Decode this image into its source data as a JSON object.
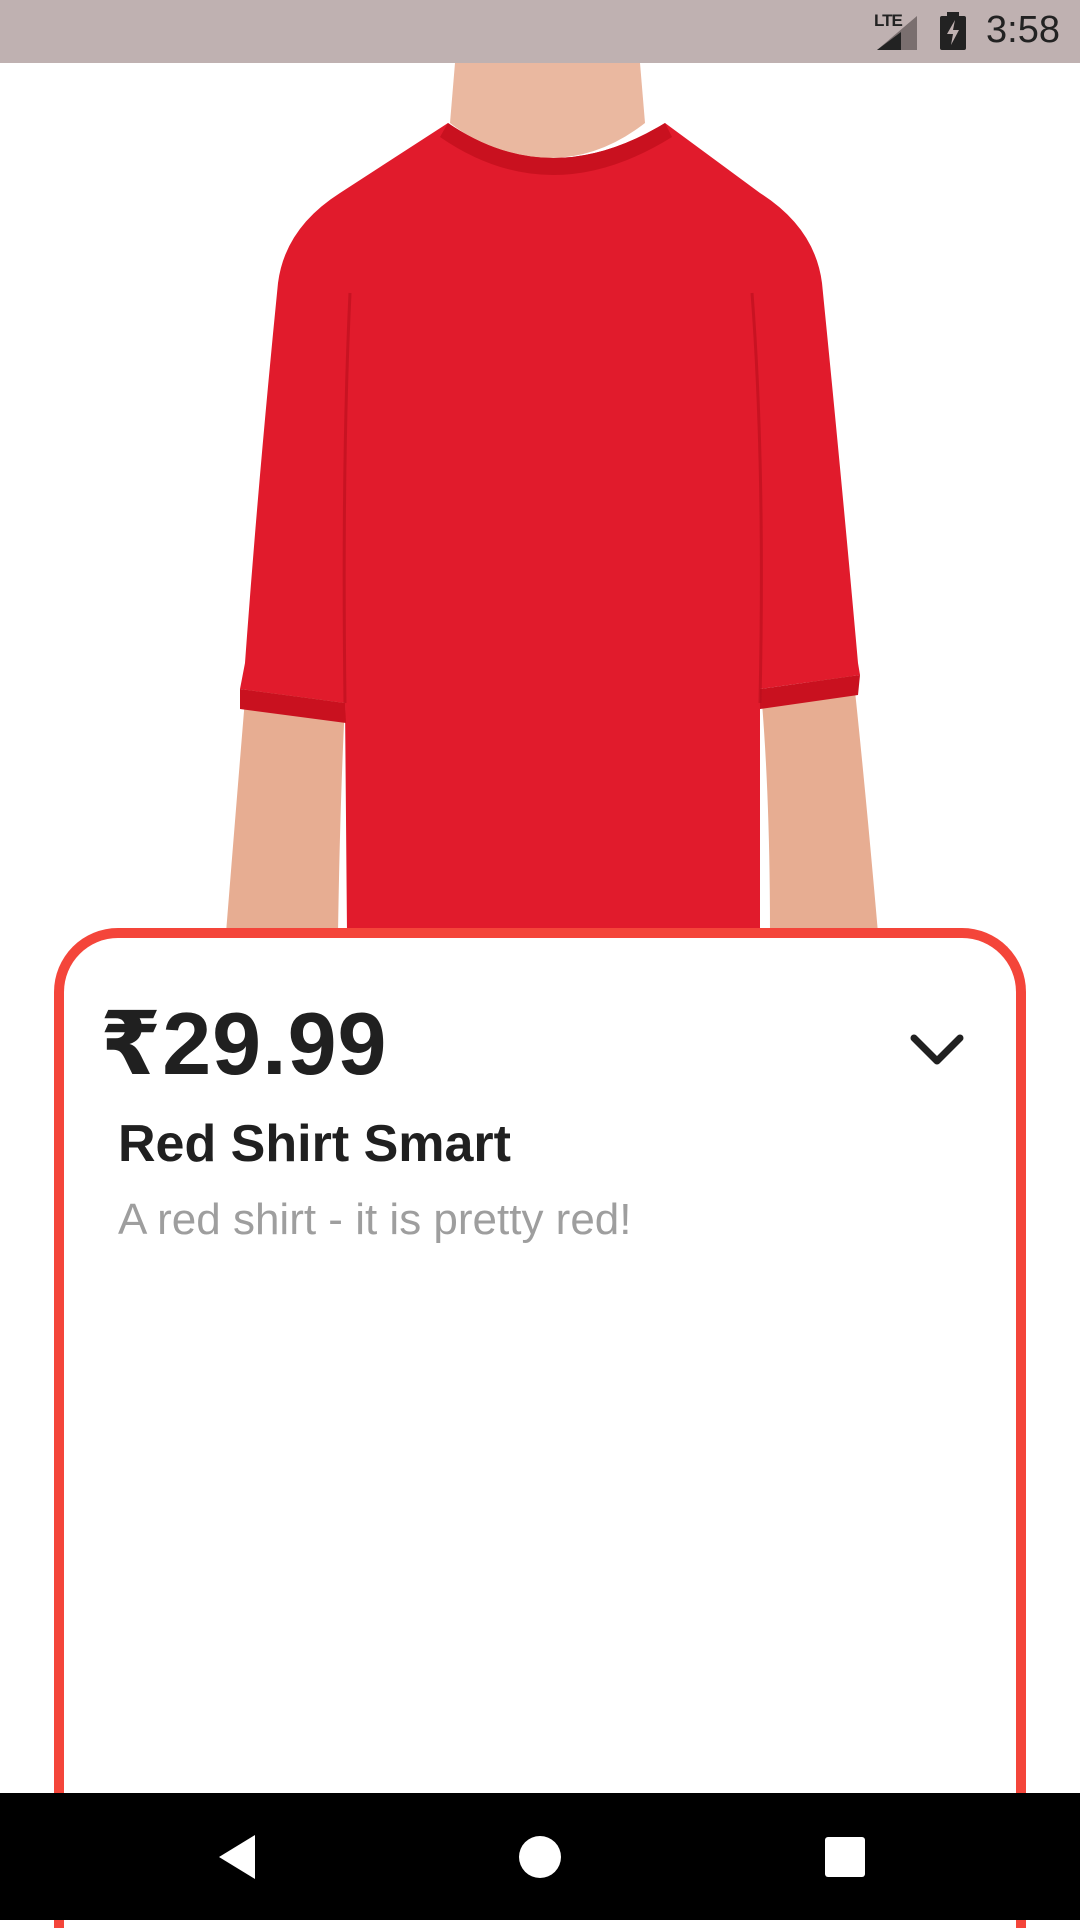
{
  "status_bar": {
    "network_label": "LTE",
    "network_icon": "signal-icon",
    "battery_icon": "battery-charging-icon",
    "time": "3:58"
  },
  "product": {
    "image_icon": "red-tshirt-photo",
    "price": "₹29.99",
    "name": "Red Shirt Smart",
    "description": "A red shirt - it is pretty red!",
    "toggle_icon": "chevron-down-icon"
  },
  "nav_bar": {
    "back_icon": "back-icon",
    "home_icon": "home-icon",
    "recents_icon": "recents-icon"
  },
  "colors": {
    "accent": "#f4453a",
    "shirt": "#e11b2c",
    "status_bar": "#bfb1b1"
  }
}
